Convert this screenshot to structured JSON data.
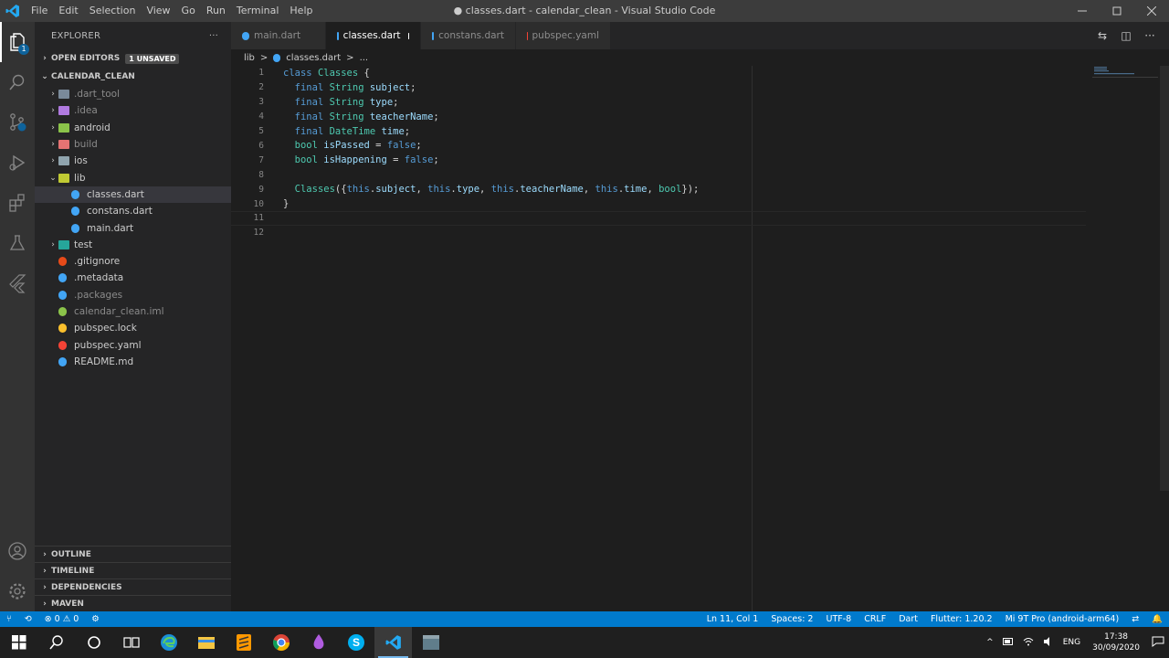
{
  "window": {
    "title": "● classes.dart - calendar_clean - Visual Studio Code",
    "menu": [
      "File",
      "Edit",
      "Selection",
      "View",
      "Go",
      "Run",
      "Terminal",
      "Help"
    ]
  },
  "activity": {
    "explorer_badge": "1"
  },
  "sidebar": {
    "title": "EXPLORER",
    "more": "···",
    "open_editors": "OPEN EDITORS",
    "unsaved": "1 UNSAVED",
    "project": "CALENDAR_CLEAN",
    "tree": [
      {
        "label": ".dart_tool",
        "chev": "›",
        "dim": true,
        "indent": 0,
        "icon": "folder-icon",
        "color": "#7a8a9a"
      },
      {
        "label": ".idea",
        "chev": "›",
        "dim": true,
        "indent": 0,
        "icon": "folder-idea-icon",
        "color": "#b07ae0"
      },
      {
        "label": "android",
        "chev": "›",
        "dim": false,
        "indent": 0,
        "icon": "folder-android-icon",
        "color": "#8bc34a"
      },
      {
        "label": "build",
        "chev": "›",
        "dim": true,
        "indent": 0,
        "icon": "folder-build-icon",
        "color": "#e57373"
      },
      {
        "label": "ios",
        "chev": "›",
        "dim": false,
        "indent": 0,
        "icon": "folder-ios-icon",
        "color": "#90a4ae"
      },
      {
        "label": "lib",
        "chev": "⌄",
        "dim": false,
        "indent": 0,
        "icon": "folder-lib-icon",
        "color": "#c0ca33"
      },
      {
        "label": "classes.dart",
        "chev": "",
        "dim": false,
        "indent": 1,
        "icon": "dart-icon",
        "color": "#42a5f5",
        "selected": true
      },
      {
        "label": "constans.dart",
        "chev": "",
        "dim": false,
        "indent": 1,
        "icon": "dart-icon",
        "color": "#42a5f5"
      },
      {
        "label": "main.dart",
        "chev": "",
        "dim": false,
        "indent": 1,
        "icon": "dart-icon",
        "color": "#42a5f5"
      },
      {
        "label": "test",
        "chev": "›",
        "dim": false,
        "indent": 0,
        "icon": "folder-test-icon",
        "color": "#26a69a"
      },
      {
        "label": ".gitignore",
        "chev": "",
        "dim": false,
        "indent": 0,
        "icon": "git-icon",
        "color": "#e64a19"
      },
      {
        "label": ".metadata",
        "chev": "",
        "dim": false,
        "indent": 0,
        "icon": "file-icon",
        "color": "#42a5f5"
      },
      {
        "label": ".packages",
        "chev": "",
        "dim": true,
        "indent": 0,
        "icon": "file-icon",
        "color": "#42a5f5"
      },
      {
        "label": "calendar_clean.iml",
        "chev": "",
        "dim": true,
        "indent": 0,
        "icon": "iml-icon",
        "color": "#8bc34a"
      },
      {
        "label": "pubspec.lock",
        "chev": "",
        "dim": false,
        "indent": 0,
        "icon": "lock-icon",
        "color": "#fbc02d"
      },
      {
        "label": "pubspec.yaml",
        "chev": "",
        "dim": false,
        "indent": 0,
        "icon": "yaml-icon",
        "color": "#f44336"
      },
      {
        "label": "README.md",
        "chev": "",
        "dim": false,
        "indent": 0,
        "icon": "info-icon",
        "color": "#42a5f5"
      }
    ],
    "bottom": [
      "OUTLINE",
      "TIMELINE",
      "DEPENDENCIES",
      "MAVEN"
    ]
  },
  "tabs": [
    {
      "label": "main.dart",
      "active": false,
      "icon": "dart-icon"
    },
    {
      "label": "classes.dart",
      "active": true,
      "dirty": true,
      "icon": "dart-icon"
    },
    {
      "label": "constans.dart",
      "active": false,
      "icon": "dart-icon"
    },
    {
      "label": "pubspec.yaml",
      "active": false,
      "icon": "yaml-icon"
    }
  ],
  "breadcrumb": {
    "folder": "lib",
    "sep": ">",
    "file": "classes.dart",
    "sep2": ">",
    "more": "..."
  },
  "code": [
    [
      [
        "kw",
        "class "
      ],
      [
        "ty",
        "Classes "
      ],
      [
        "",
        "{"
      ]
    ],
    [
      [
        "",
        "  "
      ],
      [
        "kw",
        "final "
      ],
      [
        "ty",
        "String "
      ],
      [
        "va",
        "subject"
      ],
      [
        "",
        ";"
      ]
    ],
    [
      [
        "",
        "  "
      ],
      [
        "kw",
        "final "
      ],
      [
        "ty",
        "String "
      ],
      [
        "va",
        "type"
      ],
      [
        "",
        ";"
      ]
    ],
    [
      [
        "",
        "  "
      ],
      [
        "kw",
        "final "
      ],
      [
        "ty",
        "String "
      ],
      [
        "va",
        "teacherName"
      ],
      [
        "",
        ";"
      ]
    ],
    [
      [
        "",
        "  "
      ],
      [
        "kw",
        "final "
      ],
      [
        "ty",
        "DateTime "
      ],
      [
        "va",
        "time"
      ],
      [
        "",
        ";"
      ]
    ],
    [
      [
        "",
        "  "
      ],
      [
        "ty",
        "bool "
      ],
      [
        "va",
        "isPassed"
      ],
      [
        "",
        " = "
      ],
      [
        "kw",
        "false"
      ],
      [
        "",
        ";"
      ]
    ],
    [
      [
        "",
        "  "
      ],
      [
        "ty",
        "bool "
      ],
      [
        "va",
        "isHappening"
      ],
      [
        "",
        " = "
      ],
      [
        "kw",
        "false"
      ],
      [
        "",
        ";"
      ]
    ],
    [],
    [
      [
        "",
        "  "
      ],
      [
        "fn",
        "Classes"
      ],
      [
        "",
        "({"
      ],
      [
        "kw",
        "this"
      ],
      [
        "",
        "."
      ],
      [
        "va",
        "subject"
      ],
      [
        "",
        ", "
      ],
      [
        "kw",
        "this"
      ],
      [
        "",
        "."
      ],
      [
        "va",
        "type"
      ],
      [
        "",
        ", "
      ],
      [
        "kw",
        "this"
      ],
      [
        "",
        "."
      ],
      [
        "va",
        "teacherName"
      ],
      [
        "",
        ", "
      ],
      [
        "kw",
        "this"
      ],
      [
        "",
        "."
      ],
      [
        "va",
        "time"
      ],
      [
        "",
        ", "
      ],
      [
        "ty",
        "bool"
      ],
      [
        "",
        "});"
      ]
    ],
    [
      [
        "",
        "}"
      ]
    ],
    [],
    []
  ],
  "status": {
    "left": [
      "⑂",
      "⟲",
      "⊗ 0 ⚠ 0",
      "⚙"
    ],
    "right": [
      "Ln 11, Col 1",
      "Spaces: 2",
      "UTF-8",
      "CRLF",
      "Dart",
      "Flutter: 1.20.2",
      "Mi 9T Pro (android-arm64)",
      "⇄",
      "🔔"
    ]
  },
  "taskbar": {
    "tray": [
      "^",
      "ENG"
    ],
    "time": "17:38",
    "date": "30/09/2020"
  }
}
